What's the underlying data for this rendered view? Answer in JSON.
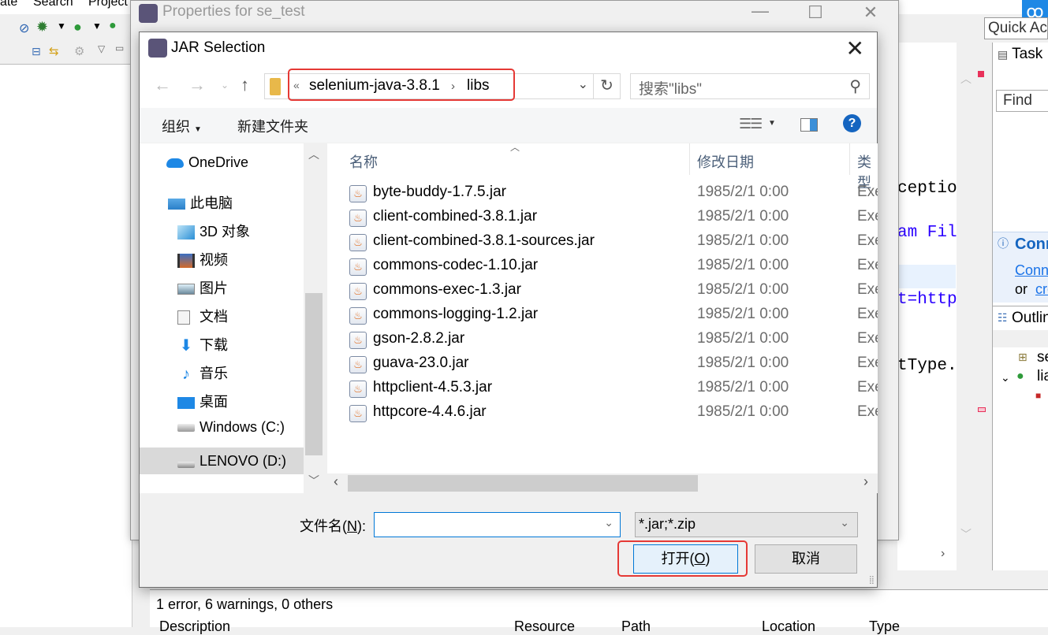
{
  "eclipse": {
    "menu_items": [
      "ate",
      "Search",
      "Project"
    ],
    "quick_access": "Quick Access",
    "code_fragments": [
      "ceptio",
      "am Fil",
      "t=http",
      "tType."
    ],
    "task_list_title": "Task List",
    "find_placeholder": "Find",
    "connect_title": "Connect Mylyn",
    "connect_link": "Connect",
    "connect_or": "or",
    "connect_create": "create",
    "outline_title": "Outline",
    "outline_items": [
      "se",
      "lia"
    ],
    "problems": {
      "summary": "1 error, 6 warnings, 0 others",
      "columns": [
        "Description",
        "Resource",
        "Path",
        "Location",
        "Type"
      ]
    }
  },
  "properties_dialog": {
    "title": "Properties for se_test"
  },
  "jar_dialog": {
    "title": "JAR Selection",
    "breadcrumb": [
      "selenium-java-3.8.1",
      "libs"
    ],
    "search_placeholder": "搜索\"libs\"",
    "commands": {
      "organize": "组织",
      "new_folder": "新建文件夹"
    },
    "nav_items": [
      {
        "label": "OneDrive",
        "icon": "cloud-icon"
      },
      {
        "label": "此电脑",
        "icon": "computer-icon"
      },
      {
        "label": "3D 对象",
        "icon": "cube-icon"
      },
      {
        "label": "视频",
        "icon": "video-icon"
      },
      {
        "label": "图片",
        "icon": "picture-icon"
      },
      {
        "label": "文档",
        "icon": "document-icon"
      },
      {
        "label": "下载",
        "icon": "download-icon"
      },
      {
        "label": "音乐",
        "icon": "music-icon"
      },
      {
        "label": "桌面",
        "icon": "desktop-icon"
      },
      {
        "label": "Windows (C:)",
        "icon": "drive-icon"
      },
      {
        "label": "LENOVO (D:)",
        "icon": "drive-icon",
        "selected": true
      }
    ],
    "columns": {
      "name": "名称",
      "date": "修改日期",
      "type": "类型"
    },
    "files": [
      {
        "name": "byte-buddy-1.7.5.jar",
        "date": "1985/2/1 0:00",
        "type": "Exe"
      },
      {
        "name": "client-combined-3.8.1.jar",
        "date": "1985/2/1 0:00",
        "type": "Exe"
      },
      {
        "name": "client-combined-3.8.1-sources.jar",
        "date": "1985/2/1 0:00",
        "type": "Exe"
      },
      {
        "name": "commons-codec-1.10.jar",
        "date": "1985/2/1 0:00",
        "type": "Exe"
      },
      {
        "name": "commons-exec-1.3.jar",
        "date": "1985/2/1 0:00",
        "type": "Exe"
      },
      {
        "name": "commons-logging-1.2.jar",
        "date": "1985/2/1 0:00",
        "type": "Exe"
      },
      {
        "name": "gson-2.8.2.jar",
        "date": "1985/2/1 0:00",
        "type": "Exe"
      },
      {
        "name": "guava-23.0.jar",
        "date": "1985/2/1 0:00",
        "type": "Exe"
      },
      {
        "name": "httpclient-4.5.3.jar",
        "date": "1985/2/1 0:00",
        "type": "Exe"
      },
      {
        "name": "httpcore-4.4.6.jar",
        "date": "1985/2/1 0:00",
        "type": "Exe"
      }
    ],
    "filename_label_prefix": "文件名(",
    "filename_label_key": "N",
    "filename_label_suffix": "):",
    "filename_value": "",
    "filter_value": "*.jar;*.zip",
    "open_label_prefix": "打开(",
    "open_label_key": "O",
    "open_label_suffix": ")",
    "cancel_label": "取消",
    "colors": {
      "highlight": "#e53935",
      "accent": "#0078d7"
    }
  }
}
